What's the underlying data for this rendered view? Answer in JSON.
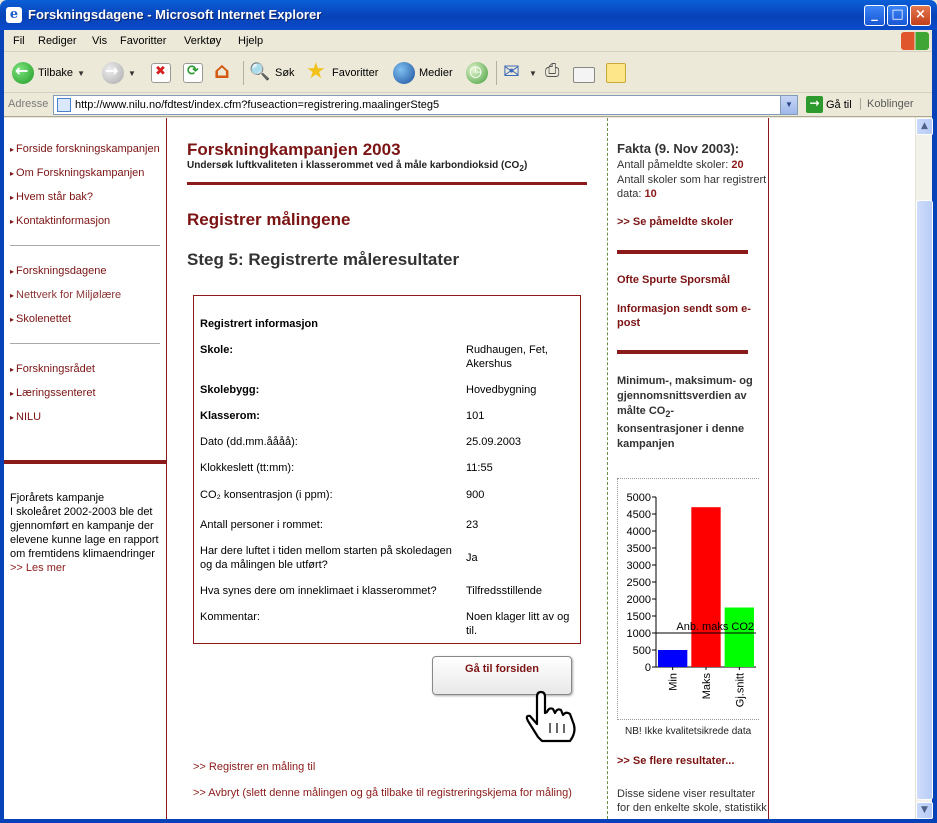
{
  "window": {
    "title": "Forskningsdagene - Microsoft Internet Explorer",
    "app_icon": "ie-e-icon",
    "minimize": "_",
    "maximize": "□",
    "close": "×"
  },
  "menu": [
    "Fil",
    "Rediger",
    "Vis",
    "Favoritter",
    "Verktøy",
    "Hjelp"
  ],
  "toolbar": {
    "back": "Tilbake",
    "search": "Søk",
    "favorites": "Favoritter",
    "media": "Medier"
  },
  "address": {
    "label": "Adresse",
    "url": "http://www.nilu.no/fdtest/index.cfm?fuseaction=registrering.maalingerSteg5",
    "go": "Gå til",
    "links": "Koblinger"
  },
  "left_nav": {
    "group1": [
      "Forside forskningskampanjen",
      "Om Forskningskampanjen",
      "Hvem står bak?",
      "Kontaktinformasjon"
    ],
    "group2": [
      "Forskningsdagene",
      "Nettverk for Miljølære",
      "Skolenettet"
    ],
    "group3": [
      "Forskningsrådet",
      "Læringssenteret",
      "NILU"
    ],
    "promo_text": "Fjorårets kampanje\nI skoleåret 2002-2003 ble det gjennomført en kampanje der elevene kunne lage en rapport om fremtidens klimaendringer",
    "promo_link": ">> Les mer"
  },
  "main": {
    "title": "Forskningkampanjen 2003",
    "subtitle_pre": "Undersøk luftkvaliteten i klasserommet ved å måle karbondioksid (CO",
    "subtitle_sub": "2",
    "subtitle_post": ")",
    "heading": "Registrer målingene",
    "step": "Steg 5: Registrerte måleresultater",
    "info_title": "Registrert informasjon",
    "rows": [
      {
        "label": "Skole:",
        "value": "Rudhaugen, Fet, Akershus",
        "bold": true
      },
      {
        "label": "Skolebygg:",
        "value": "Hovedbygning",
        "bold": true
      },
      {
        "label": "Klasserom:",
        "value": "101",
        "bold": true
      },
      {
        "label": "Dato (dd.mm.åååå):",
        "value": "25.09.2003",
        "bold": false
      },
      {
        "label": "Klokkeslett (tt:mm):",
        "value": "11:55",
        "bold": false
      },
      {
        "label": "CO₂ konsentrasjon (i ppm):",
        "value": "900",
        "bold": false
      },
      {
        "label": "Antall personer i rommet:",
        "value": "23",
        "bold": false
      },
      {
        "label": "Har dere luftet i tiden mellom starten på skoledagen og da målingen ble utført?",
        "value": "Ja",
        "bold": false
      },
      {
        "label": "Hva synes dere om inneklimaet i klasserommet?",
        "value": "Tilfredsstillende",
        "bold": false
      },
      {
        "label": "Kommentar:",
        "value": "Noen klager litt av og til.",
        "bold": false
      }
    ],
    "home_button": "Gå til forsiden",
    "link_register": ">> Registrer en måling til",
    "link_cancel": ">> Avbryt (slett denne målingen og gå tilbake til registreringskjema for måling)"
  },
  "right": {
    "facts_title": "Fakta (9. Nov 2003):",
    "fact1_text": "Antall påmeldte skoler:",
    "fact1_value": "20",
    "fact2_text": "Antall skoler som har registrert data:",
    "fact2_value": "10",
    "link_schools": ">> Se påmeldte skoler",
    "link_faq": "Ofte Spurte Sporsmål",
    "link_email": "Informasjon sendt som e-post",
    "chart_title_1": "Minimum-, maksimum- og gjennomsnittsverdien av målte",
    "chart_title_co2": "CO",
    "chart_title_sub": "2",
    "chart_title_2": "-konsentrasjoner i denne kampanjen",
    "note": "NB! Ikke kvalitetsikrede data",
    "link_more": ">> Se flere resultater...",
    "desc": "Disse sidene viser resultater for den enkelte skole, statistikk"
  },
  "chart_data": {
    "type": "bar",
    "categories": [
      "Min",
      "Maks",
      "Gj.snitt"
    ],
    "values": [
      500,
      4700,
      1750
    ],
    "colors": [
      "#0000ff",
      "#ff0000",
      "#00ff00"
    ],
    "ylim": [
      0,
      5000
    ],
    "yticks": [
      0,
      500,
      1000,
      1500,
      2000,
      2500,
      3000,
      3500,
      4000,
      4500,
      5000
    ],
    "reference_line": {
      "value": 1000,
      "label": "Anb. maks CO2"
    }
  }
}
